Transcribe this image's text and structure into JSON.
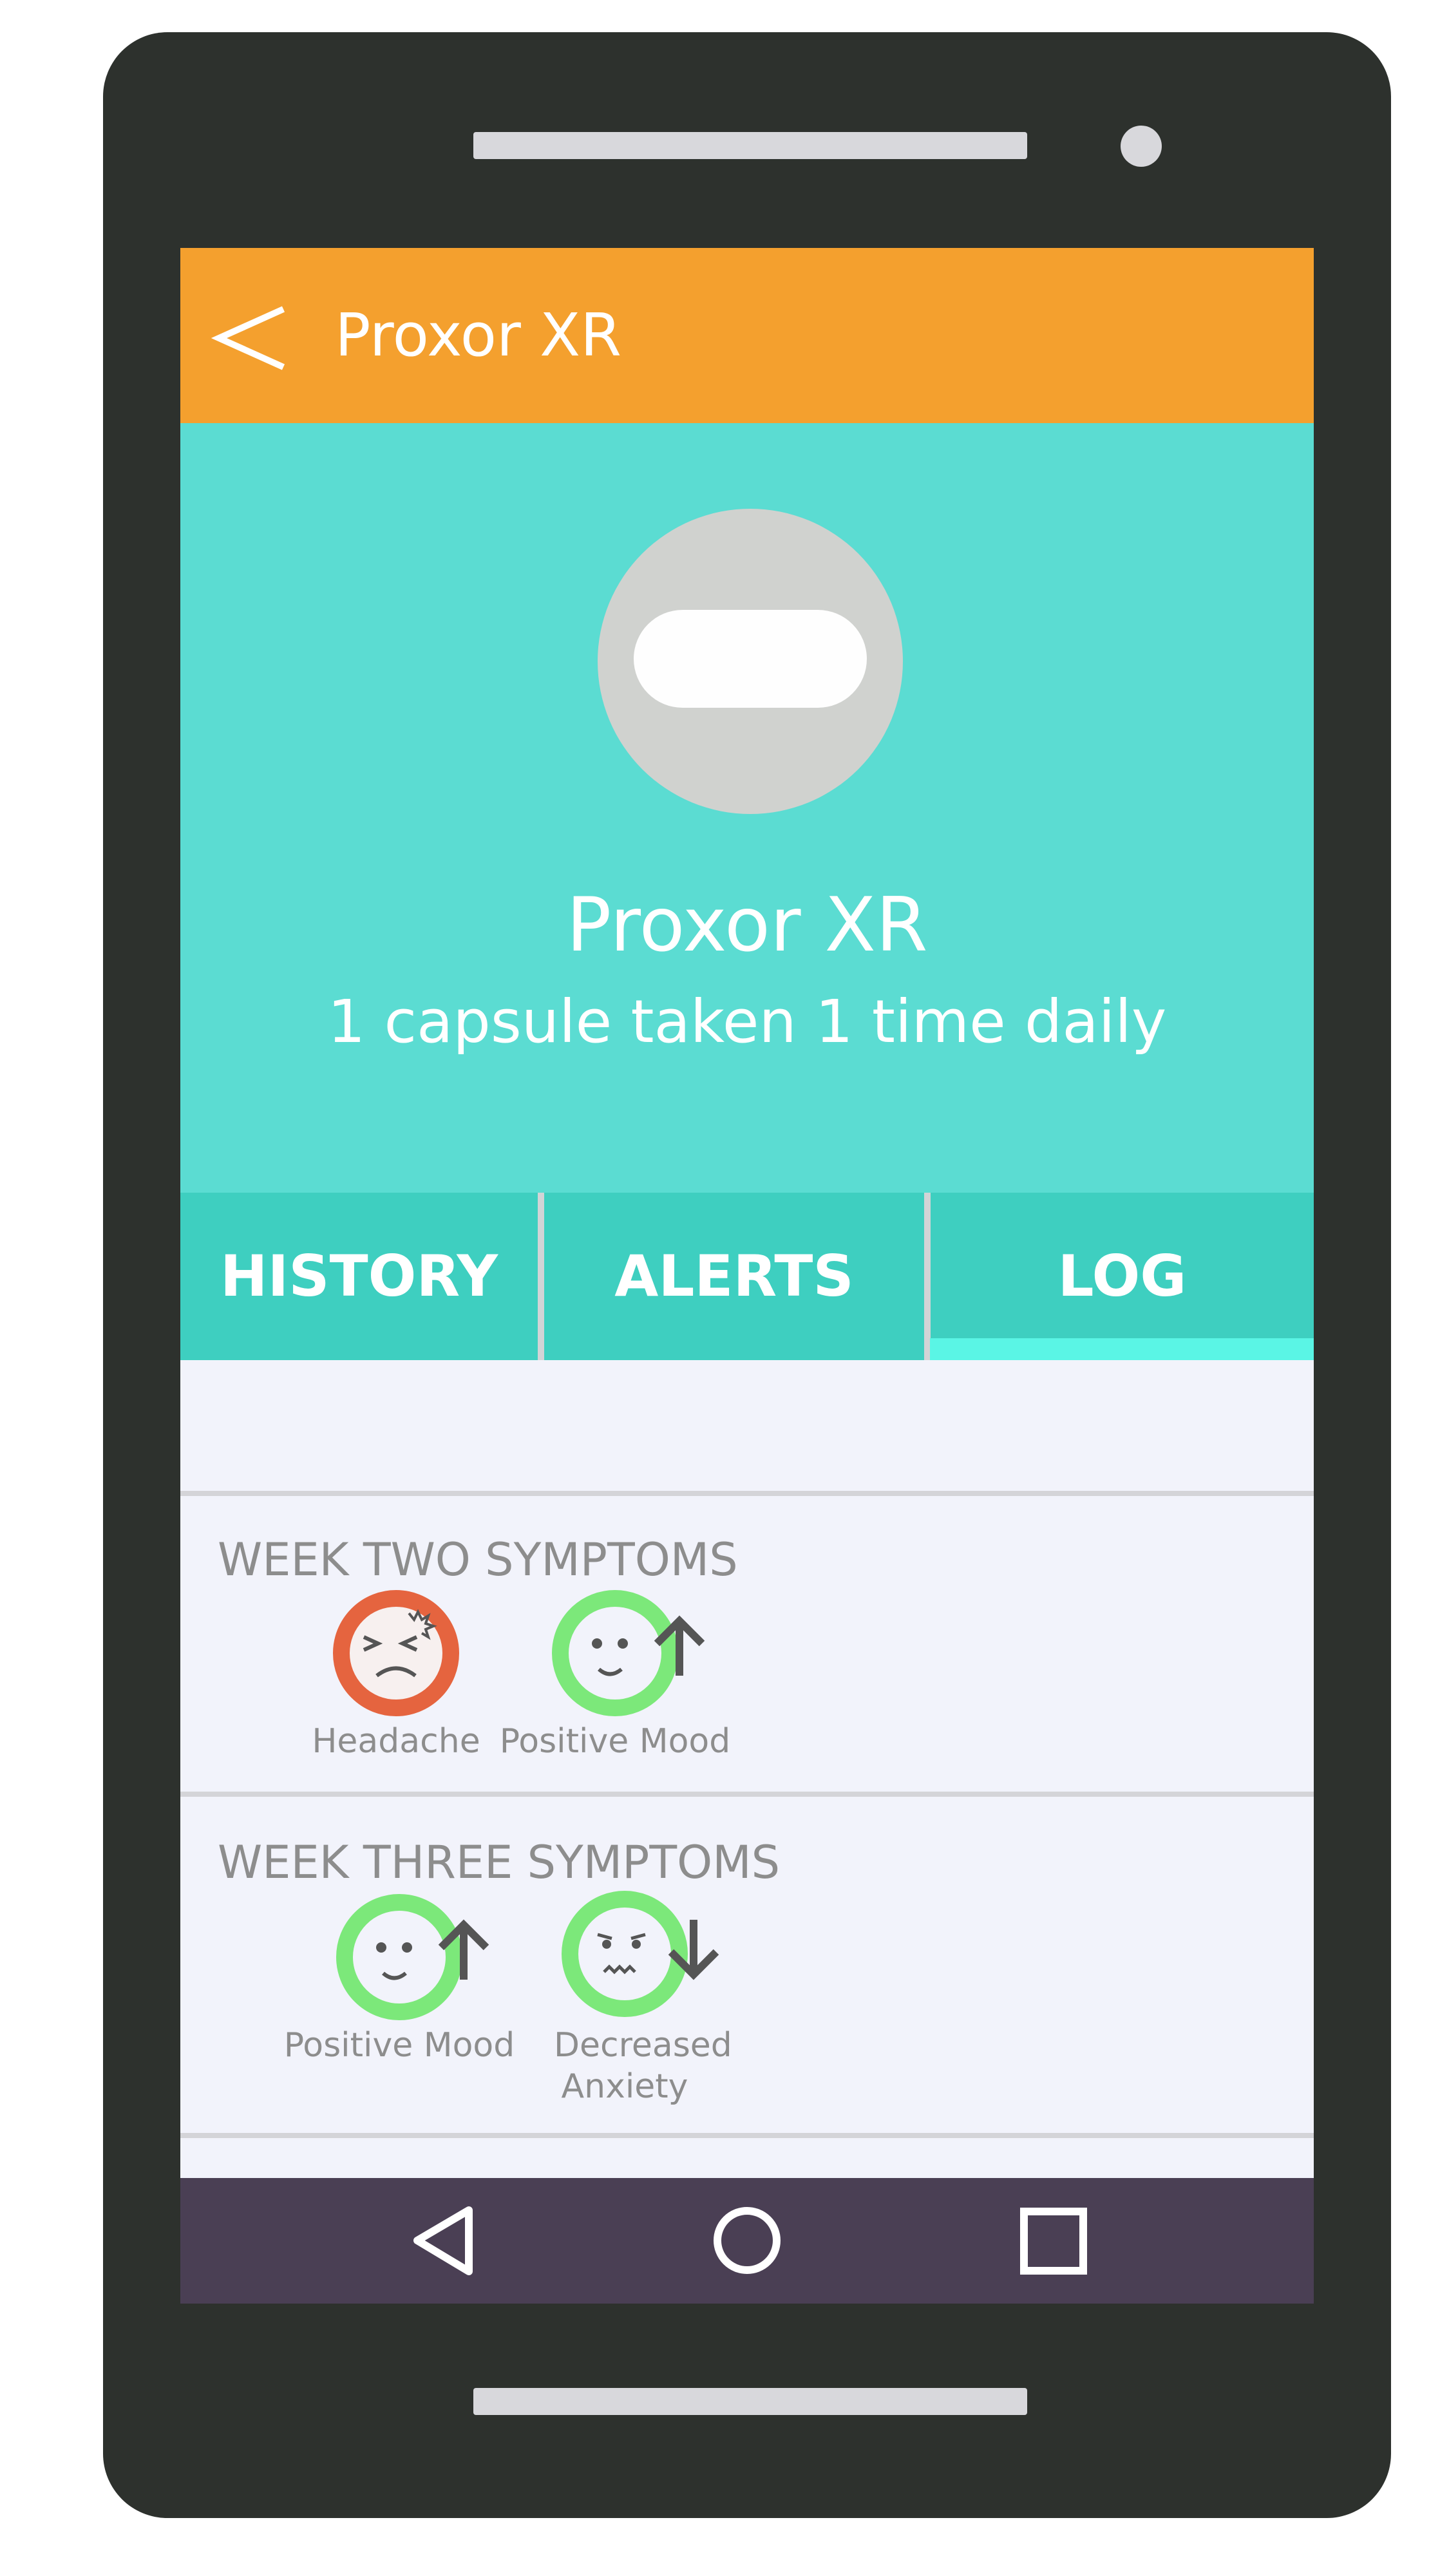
{
  "appbar": {
    "title": "Proxor XR",
    "back_icon": "back-chevron-icon"
  },
  "medication": {
    "name": "Proxor XR",
    "dosage": "1 capsule taken 1 time daily",
    "icon": "capsule-icon"
  },
  "tabs": [
    {
      "label": "HISTORY",
      "active": false
    },
    {
      "label": "ALERTS",
      "active": false
    },
    {
      "label": "LOG",
      "active": true
    }
  ],
  "sections": [
    {
      "title": "WEEK TWO SYMPTOMS",
      "symptoms": [
        {
          "label": "Headache",
          "icon": "headache-face-icon",
          "color": "#e5643f"
        },
        {
          "label": "Positive Mood",
          "icon": "happy-face-up-arrow-icon",
          "color": "#7ce87a"
        }
      ]
    },
    {
      "title": "WEEK THREE SYMPTOMS",
      "symptoms": [
        {
          "label": "Positive Mood",
          "icon": "happy-face-up-arrow-icon",
          "color": "#7ce87a"
        },
        {
          "label": "Decreased Anxiety",
          "icon": "anxious-face-down-arrow-icon",
          "color": "#7ce87a"
        }
      ]
    }
  ],
  "navbar": {
    "icons": [
      "nav-back-icon",
      "nav-home-icon",
      "nav-recents-icon"
    ]
  },
  "colors": {
    "appbar": "#f4a02e",
    "hero": "#5bdcd2",
    "tabs": "#3ecfc0",
    "tab_indicator": "#5af5e5",
    "navbar": "#4a3f54",
    "content": "#f2f3fb"
  }
}
